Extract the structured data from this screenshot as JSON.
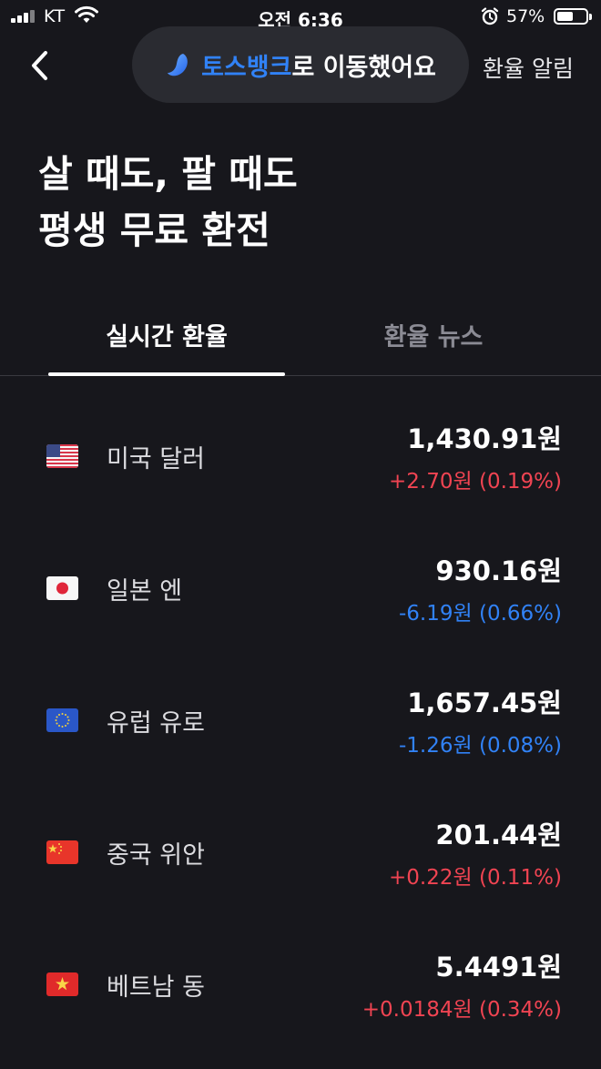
{
  "status_bar": {
    "carrier": "KT",
    "time": "오전 6:36",
    "battery": "57%",
    "battery_level": 0.57
  },
  "nav": {
    "toast_brand": "토스뱅크",
    "toast_rest": "로 이동했어요",
    "alert_link": "환율 알림"
  },
  "hero": {
    "line1": "살 때도, 팔 때도",
    "line2": "평생 무료 환전"
  },
  "tabs": [
    {
      "label": "실시간 환율",
      "active": true
    },
    {
      "label": "환율 뉴스",
      "active": false
    }
  ],
  "currencies": [
    {
      "name": "미국 달러",
      "rate": "1,430.91원",
      "change": "+2.70원 (0.19%)",
      "direction": "up",
      "flag": "us-flag"
    },
    {
      "name": "일본 엔",
      "rate": "930.16원",
      "change": "-6.19원 (0.66%)",
      "direction": "down",
      "flag": "japan-flag"
    },
    {
      "name": "유럽 유로",
      "rate": "1,657.45원",
      "change": "-1.26원 (0.08%)",
      "direction": "down",
      "flag": "eu-flag"
    },
    {
      "name": "중국 위안",
      "rate": "201.44원",
      "change": "+0.22원 (0.11%)",
      "direction": "up",
      "flag": "china-flag"
    },
    {
      "name": "베트남 동",
      "rate": "5.4491원",
      "change": "+0.0184원 (0.34%)",
      "direction": "up",
      "flag": "vietnam-flag"
    }
  ],
  "colors": {
    "background": "#17171c",
    "brand_blue": "#3182f6",
    "up_red": "#f04452",
    "down_blue": "#3182f6"
  }
}
